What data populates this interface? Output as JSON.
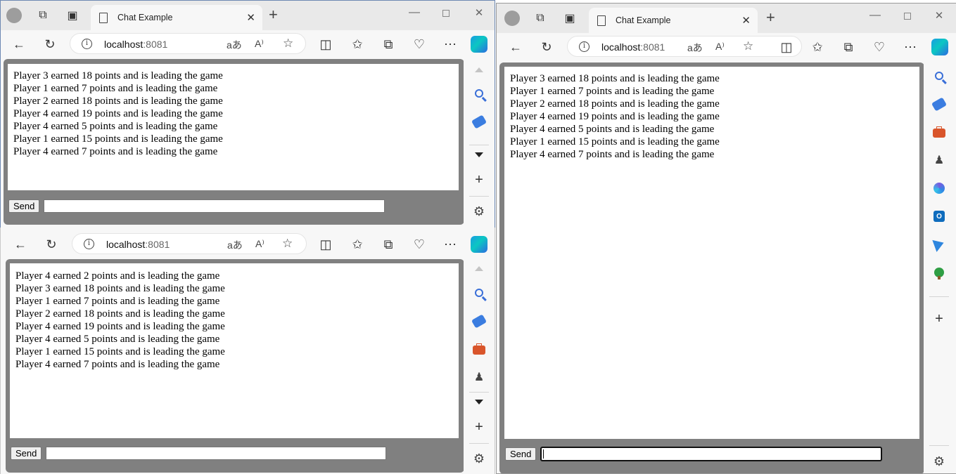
{
  "colors": {
    "page_bg": "#808080",
    "log_bg": "#ffffff",
    "chrome_bg": "#f7f7f7",
    "tabstrip_bg": "#e9e9e9"
  },
  "windows": [
    {
      "tab_title": "Chat Example",
      "url_host": "localhost",
      "url_port": ":8081",
      "send_label": "Send",
      "message_value": "",
      "log": [
        "Player 3 earned 18 points and is leading the game",
        "Player 1 earned 7 points and is leading the game",
        "Player 2 earned 18 points and is leading the game",
        "Player 4 earned 19 points and is leading the game",
        "Player 4 earned 5 points and is leading the game",
        "Player 1 earned 15 points and is leading the game",
        "Player 4 earned 7 points and is leading the game"
      ]
    },
    {
      "url_host": "localhost",
      "url_port": ":8081",
      "send_label": "Send",
      "message_value": "",
      "log": [
        "Player 4 earned 2 points and is leading the game",
        "Player 3 earned 18 points and is leading the game",
        "Player 1 earned 7 points and is leading the game",
        "Player 2 earned 18 points and is leading the game",
        "Player 4 earned 19 points and is leading the game",
        "Player 4 earned 5 points and is leading the game",
        "Player 1 earned 15 points and is leading the game",
        "Player 4 earned 7 points and is leading the game"
      ]
    },
    {
      "tab_title": "Chat Example",
      "url_host": "localhost",
      "url_port": ":8081",
      "send_label": "Send",
      "message_value": "",
      "log": [
        "Player 3 earned 18 points and is leading the game",
        "Player 1 earned 7 points and is leading the game",
        "Player 2 earned 18 points and is leading the game",
        "Player 4 earned 19 points and is leading the game",
        "Player 4 earned 5 points and is leading the game",
        "Player 1 earned 15 points and is leading the game",
        "Player 4 earned 7 points and is leading the game"
      ]
    }
  ],
  "icons": {
    "toolbar": [
      "back-icon",
      "refresh-icon",
      "split-screen-icon",
      "favorites-icon",
      "collections-icon",
      "browser-essentials-icon",
      "more-icon",
      "copilot-icon"
    ],
    "address": [
      "site-info-icon",
      "translate-icon",
      "read-aloud-icon",
      "favorite-star-icon"
    ],
    "sidebar": [
      "search-icon",
      "shopping-icon",
      "tools-icon",
      "games-icon",
      "microsoft-365-icon",
      "outlook-icon",
      "drop-icon",
      "tree-icon",
      "add-icon",
      "settings-icon"
    ]
  }
}
